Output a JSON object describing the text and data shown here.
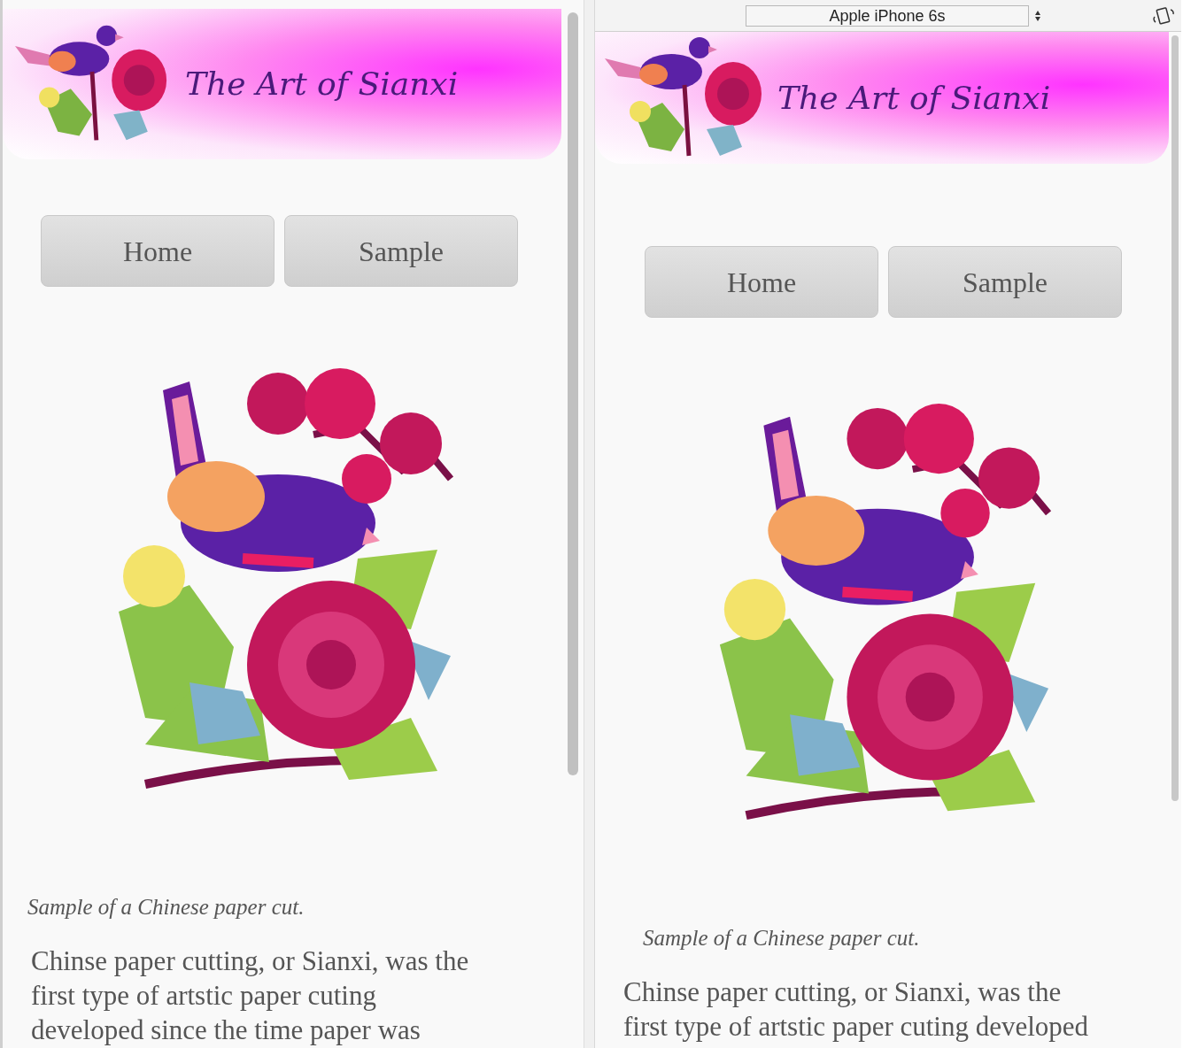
{
  "panes": [
    {
      "kind": "desktop",
      "header": {
        "title": "The Art of Sianxi"
      },
      "nav": [
        {
          "label": "Home"
        },
        {
          "label": "Sample"
        }
      ],
      "caption": "Sample of a Chinese paper cut.",
      "paragraph_lines": [
        "Chinse paper cutting, or Sianxi, was the",
        "first type of artstic paper cuting",
        "developed since the time paper was"
      ]
    },
    {
      "kind": "device",
      "device_select": "Apple iPhone 6s",
      "header": {
        "title": "The Art of Sianxi"
      },
      "nav": [
        {
          "label": "Home"
        },
        {
          "label": "Sample"
        }
      ],
      "caption": "Sample of a Chinese paper cut.",
      "paragraph_lines": [
        "Chinse paper cutting, or Sianxi, was the",
        "first type of artstic paper cuting developed"
      ]
    }
  ]
}
